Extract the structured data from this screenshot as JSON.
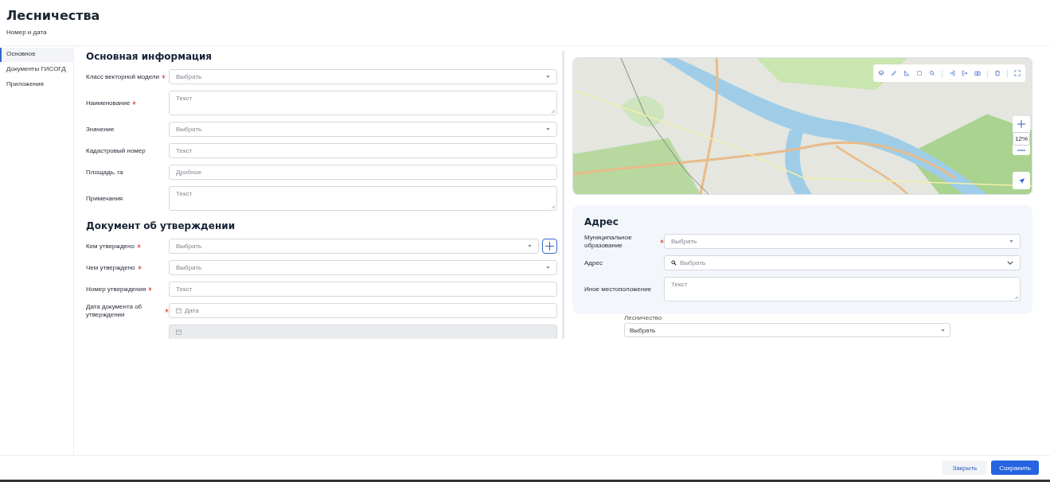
{
  "header": {
    "title": "Лесничества",
    "subtitle": "Номер и дата"
  },
  "sidebar": {
    "items": [
      {
        "label": "Основное",
        "selected": true
      },
      {
        "label": "Документы ГИСОГД",
        "selected": false
      },
      {
        "label": "Приложения",
        "selected": false
      }
    ]
  },
  "sections": [
    {
      "title": "Основная информация",
      "fields": [
        {
          "label": "Класс векторной модели",
          "required": true,
          "kind": "select",
          "placeholder": "Выбрать",
          "disabled": false
        },
        {
          "label": "Наименование",
          "required": true,
          "kind": "textarea",
          "placeholder": "Текст",
          "disabled": false
        },
        {
          "label": "Значение",
          "required": false,
          "kind": "select",
          "placeholder": "Выбрать",
          "disabled": false
        },
        {
          "label": "Кадастровый номер",
          "required": false,
          "kind": "text",
          "placeholder": "Текст",
          "disabled": false
        },
        {
          "label": "Площадь, га",
          "required": false,
          "kind": "text",
          "placeholder": "Дробное",
          "disabled": false
        },
        {
          "label": "Примечания",
          "required": false,
          "kind": "textarea",
          "placeholder": "Текст",
          "disabled": false
        }
      ]
    },
    {
      "title": "Документ об утверждении",
      "fields": [
        {
          "label": "Кем утверждено",
          "required": true,
          "kind": "select",
          "placeholder": "Выбрать",
          "disabled": false,
          "add_button": true
        },
        {
          "label": "Чем утверждено",
          "required": true,
          "kind": "select",
          "placeholder": "Выбрать",
          "disabled": false
        },
        {
          "label": "Номер утверждения",
          "required": true,
          "kind": "text",
          "placeholder": "Текст",
          "disabled": false
        },
        {
          "label": "Дата документа об утверждении",
          "required": true,
          "kind": "date",
          "placeholder": "Дата",
          "disabled": false
        },
        {
          "kind": "date",
          "disabled": true
        }
      ]
    }
  ],
  "map": {
    "zoom": "12%"
  },
  "address": {
    "title": "Адрес",
    "fields": [
      {
        "label": "Муниципальное образование",
        "required": true,
        "kind": "select",
        "placeholder": "Выбрать"
      },
      {
        "label": "Адрес",
        "required": false,
        "kind": "search",
        "placeholder": "Выбрать"
      },
      {
        "label": "Иное местоположение",
        "required": false,
        "kind": "textarea",
        "placeholder": "Текст"
      }
    ]
  },
  "forestry": {
    "label": "Лесничество",
    "value": "Выбрать"
  },
  "buttons": [
    {
      "label": "Закрыть",
      "kind": "secondary"
    },
    {
      "label": "Сохранить",
      "kind": "primary"
    }
  ]
}
